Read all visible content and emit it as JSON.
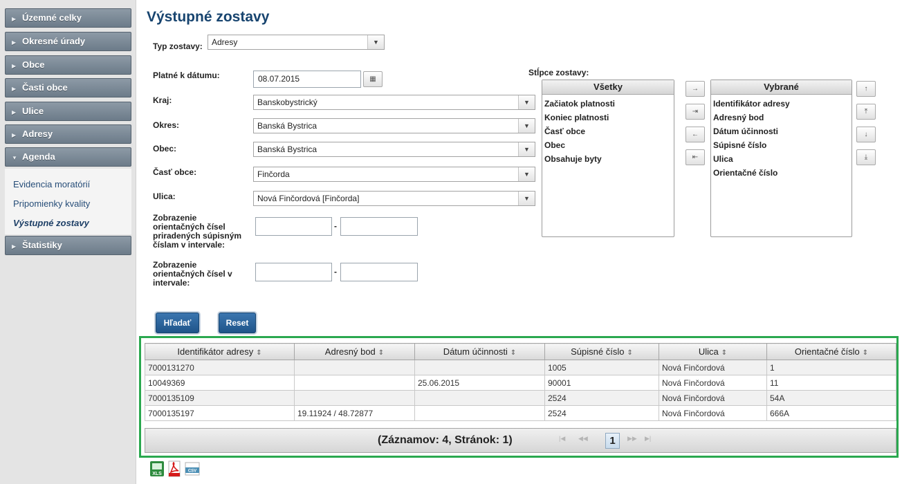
{
  "sidebar": {
    "items": [
      {
        "label": "Územné celky",
        "arrow": "▶"
      },
      {
        "label": "Okresné úrady",
        "arrow": "▶"
      },
      {
        "label": "Obce",
        "arrow": "▶"
      },
      {
        "label": "Časti obce",
        "arrow": "▶"
      },
      {
        "label": "Ulice",
        "arrow": "▶"
      },
      {
        "label": "Adresy",
        "arrow": "▶"
      },
      {
        "label": "Agenda",
        "arrow": "▼"
      }
    ],
    "subitems": [
      {
        "label": "Evidencia moratórií"
      },
      {
        "label": "Pripomienky kvality"
      },
      {
        "label": "Výstupné zostavy"
      }
    ],
    "last_item": {
      "label": "Štatistiky",
      "arrow": "▶"
    }
  },
  "page": {
    "title": "Výstupné zostavy"
  },
  "form": {
    "typ_label": "Typ zostavy:",
    "typ_value": "Adresy",
    "datum_label": "Platné k dátumu:",
    "datum_value": "08.07.2015",
    "kraj_label": "Kraj:",
    "kraj_value": "Banskobystrický",
    "okres_label": "Okres:",
    "okres_value": "Banská Bystrica",
    "obec_label": "Obec:",
    "obec_value": "Banská Bystrica",
    "cast_label": "Časť obce:",
    "cast_value": "Finčorda",
    "ulica_label": "Ulica:",
    "ulica_value": "Nová Finčordová [Finčorda]",
    "range1_label": "Zobrazenie orientačných čísel priradených súpisným číslam v intervale:",
    "range2_label": "Zobrazenie orientačných čísel v intervale:",
    "dash": "-",
    "search_btn": "Hľadať",
    "reset_btn": "Reset"
  },
  "columns": {
    "label": "Stĺpce zostavy:",
    "all_header": "Všetky",
    "all_items": [
      "Začiatok platnosti",
      "Koniec platnosti",
      "Časť obce",
      "Obec",
      "Obsahuje byty"
    ],
    "selected_header": "Vybrané",
    "selected_items": [
      "Identifikátor adresy",
      "Adresný bod",
      "Dátum účinnosti",
      "Súpisné číslo",
      "Ulica",
      "Orientačné číslo"
    ]
  },
  "table": {
    "headers": [
      "Identifikátor adresy",
      "Adresný bod",
      "Dátum účinnosti",
      "Súpisné číslo",
      "Ulica",
      "Orientačné číslo"
    ],
    "rows": [
      [
        "7000131270",
        "",
        "",
        "1005",
        "Nová Finčordová",
        "1"
      ],
      [
        "10049369",
        "",
        "25.06.2015",
        "90001",
        "Nová Finčordová",
        "11"
      ],
      [
        "7000135109",
        "",
        "",
        "2524",
        "Nová Finčordová",
        "54A"
      ],
      [
        "7000135197",
        "19.11924 / 48.72877",
        "",
        "2524",
        "Nová Finčordová",
        "666A"
      ]
    ],
    "pager_info": "(Záznamov: 4, Stránok: 1)",
    "current_page": "1"
  },
  "icons": {
    "calendar": "calendar-icon",
    "export": [
      "xls-export-icon",
      "pdf-export-icon",
      "csv-export-icon"
    ]
  }
}
